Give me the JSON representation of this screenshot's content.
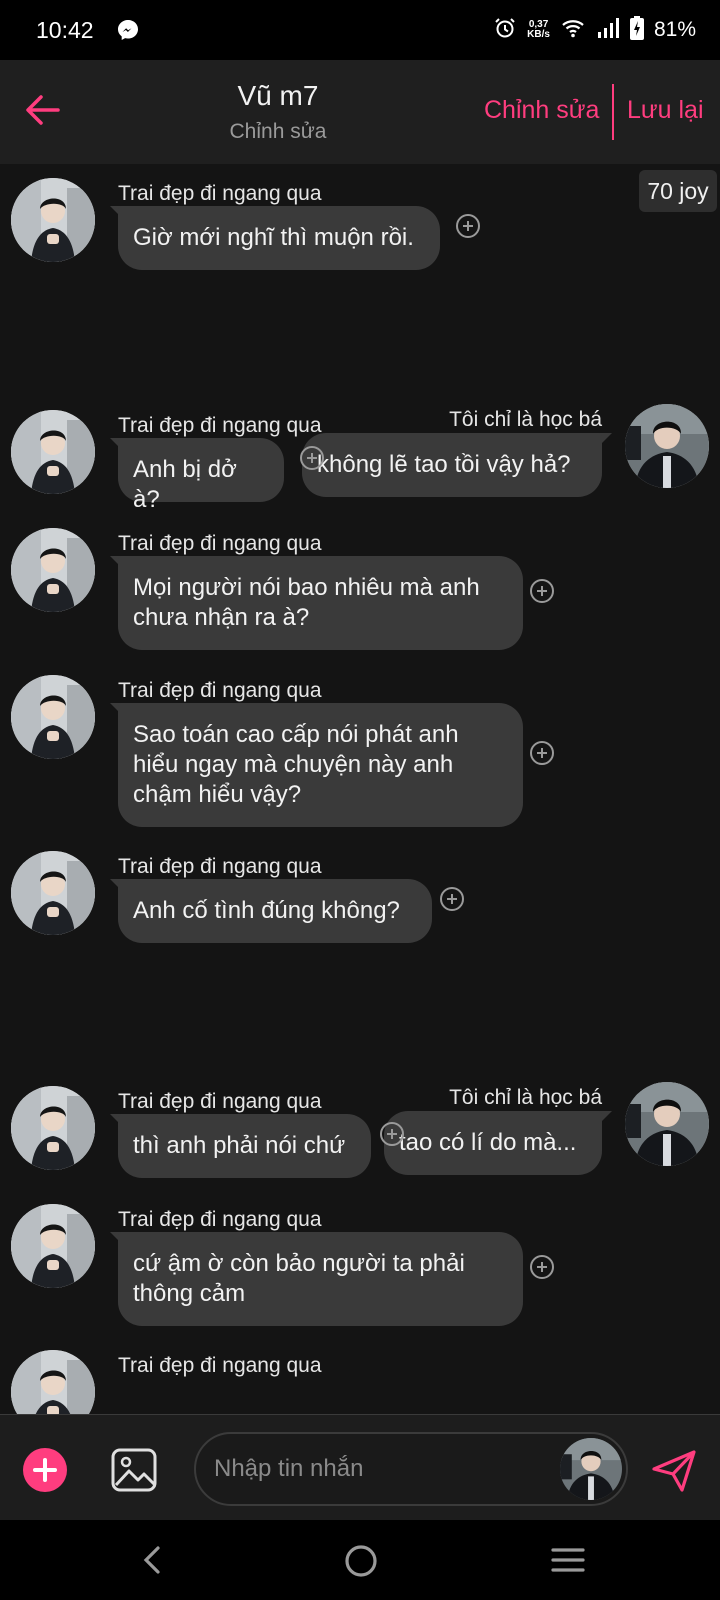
{
  "status_bar": {
    "time": "10:42",
    "speed_value": "0,37",
    "speed_unit": "KB/s",
    "battery": "81%",
    "icons": [
      "messenger-icon",
      "alarm-icon",
      "wifi-icon",
      "signal-icon",
      "battery-icon"
    ]
  },
  "header": {
    "title": "Vũ m7",
    "subtitle": "Chỉnh sửa",
    "edit_label": "Chỉnh sửa",
    "save_label": "Lưu lại"
  },
  "joy_badge": "70 joy",
  "messages": [
    {
      "side": "left",
      "sender": "Trai đẹp đi ngang qua",
      "text": "Giờ mới nghĩ thì muộn rồi."
    },
    {
      "side": "right",
      "sender": "Tôi chỉ là học bá",
      "text": "không lẽ tao tồi vậy hả?"
    },
    {
      "side": "left",
      "sender": "Trai đẹp đi ngang qua",
      "text": "Anh bị dở à?"
    },
    {
      "side": "left",
      "sender": "Trai đẹp đi ngang qua",
      "text": "Mọi người nói bao nhiêu mà anh chưa nhận ra à?"
    },
    {
      "side": "left",
      "sender": "Trai đẹp đi ngang qua",
      "text": "Sao toán cao cấp nói phát anh hiểu ngay mà chuyện này anh chậm hiểu vậy?"
    },
    {
      "side": "left",
      "sender": "Trai đẹp đi ngang qua",
      "text": "Anh cố tình đúng không?"
    },
    {
      "side": "right",
      "sender": "Tôi chỉ là học bá",
      "text": "tao có lí do mà..."
    },
    {
      "side": "left",
      "sender": "Trai đẹp đi ngang qua",
      "text": "thì anh phải nói chứ"
    },
    {
      "side": "left",
      "sender": "Trai đẹp đi ngang qua",
      "text": "cứ ậm ờ còn bảo người ta phải thông cảm"
    },
    {
      "side": "left",
      "sender": "Trai đẹp đi ngang qua",
      "text": ""
    }
  ],
  "composer": {
    "placeholder": "Nhập tin nhắn"
  },
  "colors": {
    "accent": "#ff3d7f",
    "bubble": "#3a3a3a",
    "background": "#141414"
  }
}
